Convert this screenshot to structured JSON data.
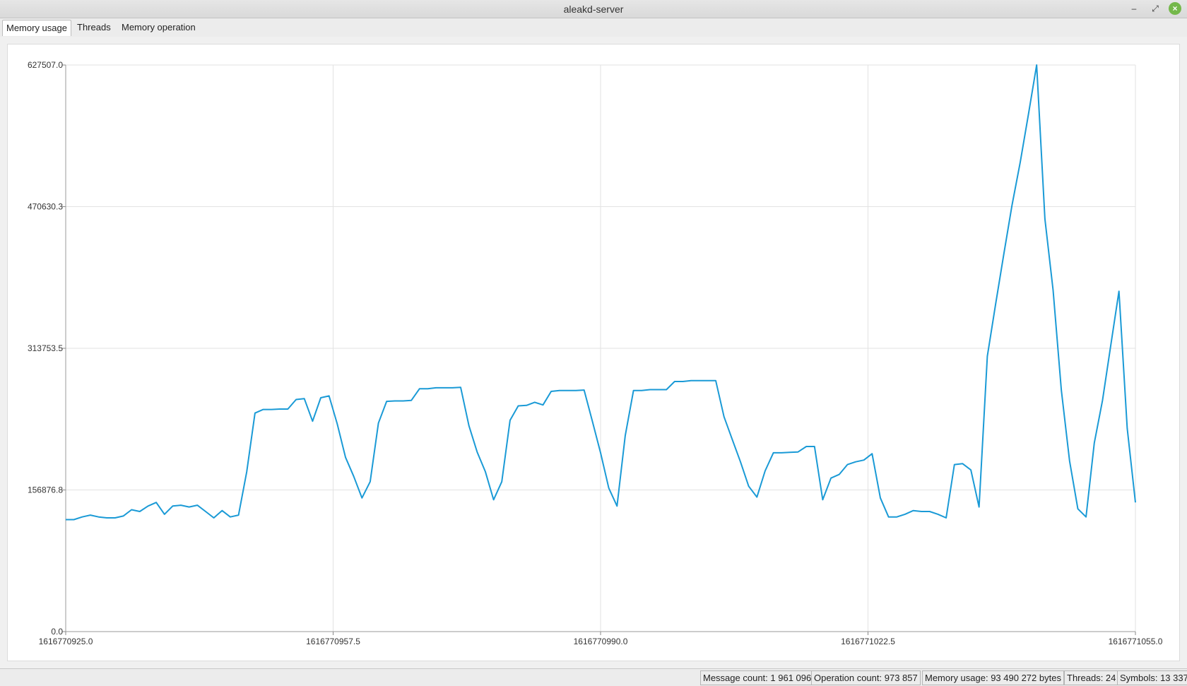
{
  "window": {
    "title": "aleakd-server"
  },
  "tabs": [
    {
      "label": "Memory usage",
      "active": true
    },
    {
      "label": "Threads",
      "active": false
    },
    {
      "label": "Memory operation",
      "active": false
    }
  ],
  "chart_data": {
    "type": "line",
    "title": "",
    "xlabel": "",
    "ylabel": "",
    "color": "#1a9ad6",
    "grid": true,
    "legend": "none",
    "xlim": [
      1616770925.0,
      1616771055.0
    ],
    "ylim": [
      0.0,
      627507.0
    ],
    "x_ticks": [
      "1616770925.0",
      "1616770957.5",
      "1616770990.0",
      "1616771022.5",
      "1616771055.0"
    ],
    "y_ticks": [
      "0.0",
      "156876.8",
      "313753.5",
      "470630.3",
      "627507.0"
    ],
    "series": [
      {
        "x": [
          1616770925.0,
          1616770926.0,
          1616770927.0,
          1616770928.0,
          1616770929.0,
          1616770930.0,
          1616770931.0,
          1616770932.0,
          1616770933.0,
          1616770934.0,
          1616770935.0,
          1616770936.0,
          1616770937.0,
          1616770938.0,
          1616770939.0,
          1616770940.0,
          1616770941.0,
          1616770942.0,
          1616770943.0,
          1616770944.0,
          1616770945.0,
          1616770946.0,
          1616770947.0,
          1616770948.0,
          1616770949.0,
          1616770950.0,
          1616770951.0,
          1616770952.0,
          1616770953.0,
          1616770954.0,
          1616770955.0,
          1616770956.0,
          1616770957.0,
          1616770958.0,
          1616770959.0,
          1616770960.0,
          1616770961.0,
          1616770962.0,
          1616770963.0,
          1616770964.0,
          1616770965.0,
          1616770966.0,
          1616770967.0,
          1616770968.0,
          1616770969.0,
          1616770970.0,
          1616770971.0,
          1616770972.0,
          1616770973.0,
          1616770974.0,
          1616770975.0,
          1616770976.0,
          1616770977.0,
          1616770978.0,
          1616770979.0,
          1616770980.0,
          1616770981.0,
          1616770982.0,
          1616770983.0,
          1616770984.0,
          1616770985.0,
          1616770986.0,
          1616770987.0,
          1616770988.0,
          1616770989.0,
          1616770990.0,
          1616770991.0,
          1616770992.0,
          1616770993.0,
          1616770994.0,
          1616770995.0,
          1616770996.0,
          1616770997.0,
          1616770998.0,
          1616770999.0,
          1616771000.0,
          1616771001.0,
          1616771002.0,
          1616771003.0,
          1616771004.0,
          1616771005.0,
          1616771006.0,
          1616771007.0,
          1616771008.0,
          1616771009.0,
          1616771010.0,
          1616771011.0,
          1616771012.0,
          1616771013.0,
          1616771014.0,
          1616771015.0,
          1616771016.0,
          1616771017.0,
          1616771018.0,
          1616771019.0,
          1616771020.0,
          1616771021.0,
          1616771022.0,
          1616771023.0,
          1616771024.0,
          1616771025.0,
          1616771026.0,
          1616771027.0,
          1616771028.0,
          1616771029.0,
          1616771030.0,
          1616771031.0,
          1616771032.0,
          1616771033.0,
          1616771034.0,
          1616771035.0,
          1616771036.0,
          1616771037.0,
          1616771038.0,
          1616771039.0,
          1616771040.0,
          1616771041.0,
          1616771042.0,
          1616771043.0,
          1616771044.0,
          1616771045.0,
          1616771046.0,
          1616771047.0,
          1616771048.0,
          1616771049.0,
          1616771050.0,
          1616771051.0,
          1616771052.0,
          1616771053.0,
          1616771054.0,
          1616771055.0
        ],
        "y": [
          124000,
          124000,
          127000,
          129000,
          127000,
          126000,
          126000,
          128000,
          135000,
          133000,
          139000,
          143000,
          130000,
          139000,
          140000,
          138000,
          140000,
          133000,
          126000,
          134000,
          127000,
          129000,
          177000,
          242000,
          246000,
          246000,
          246500,
          246500,
          257000,
          258000,
          233000,
          259000,
          261000,
          230000,
          193000,
          172000,
          148000,
          166000,
          231000,
          255000,
          255500,
          255500,
          256000,
          269000,
          269000,
          270000,
          270000,
          270000,
          270500,
          228000,
          199000,
          177000,
          146000,
          166000,
          234000,
          250000,
          250500,
          254000,
          251000,
          266000,
          267000,
          267000,
          267000,
          267500,
          233000,
          198000,
          159000,
          139000,
          217000,
          267000,
          267000,
          268000,
          268000,
          268000,
          277000,
          277000,
          278000,
          278000,
          278000,
          278000,
          238000,
          213000,
          188000,
          161000,
          149000,
          178000,
          198000,
          198000,
          198500,
          199000,
          205000,
          205000,
          146000,
          170000,
          174000,
          185000,
          188000,
          190000,
          197000,
          148000,
          127000,
          127000,
          130000,
          134000,
          133000,
          133000,
          130000,
          126000,
          185000,
          186000,
          179000,
          138000,
          305000,
          362000,
          418000,
          472000,
          520000,
          573000,
          627507,
          457000,
          378000,
          267000,
          189000,
          136000,
          127000,
          209000,
          256000,
          317000,
          377000,
          225000,
          143000
        ]
      }
    ]
  },
  "status": {
    "message_count": "Message count: 1 961 096",
    "operation_count": "Operation count: 973 857",
    "memory_usage": "Memory usage: 93 490 272 bytes",
    "threads": "Threads: 24",
    "symbols": "Symbols: 13 337"
  }
}
